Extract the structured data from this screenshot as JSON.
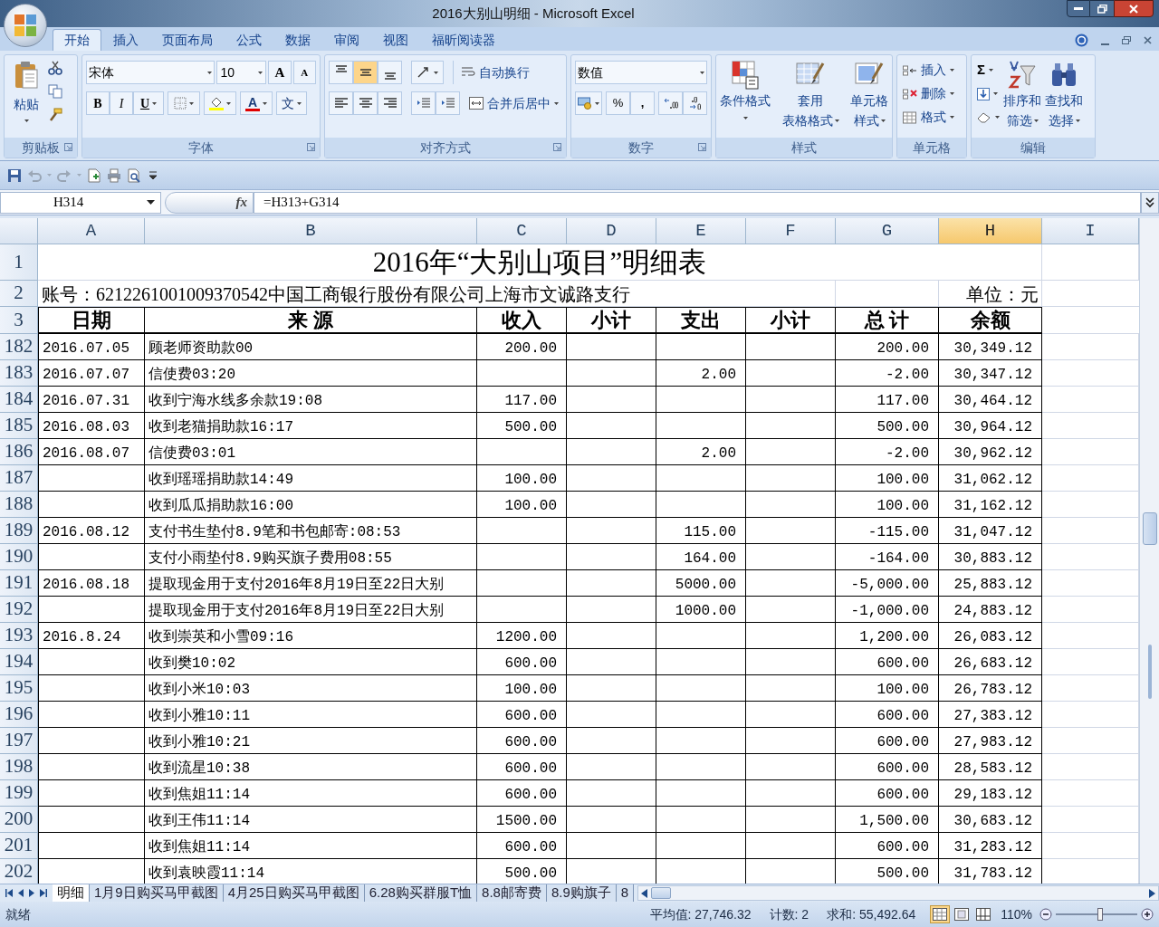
{
  "window": {
    "title": "2016大别山明细 - Microsoft Excel"
  },
  "ribbon_tabs": [
    {
      "label": "开始",
      "selected": true
    },
    {
      "label": "插入",
      "selected": false
    },
    {
      "label": "页面布局",
      "selected": false
    },
    {
      "label": "公式",
      "selected": false
    },
    {
      "label": "数据",
      "selected": false
    },
    {
      "label": "审阅",
      "selected": false
    },
    {
      "label": "视图",
      "selected": false
    },
    {
      "label": "福昕阅读器",
      "selected": false
    }
  ],
  "ribbon": {
    "clipboard": {
      "paste": "粘贴",
      "label": "剪贴板"
    },
    "font": {
      "name": "宋体",
      "size": "10",
      "grow": "A",
      "shrink": "A",
      "bold": "B",
      "italic": "I",
      "underline": "U",
      "font_color": "A",
      "phonetic": "文",
      "label": "字体"
    },
    "alignment": {
      "vertical": [
        {
          "selected": false
        },
        {
          "selected": true
        },
        {
          "selected": false
        }
      ],
      "wrap": "自动换行",
      "merge": "合并后居中",
      "label": "对齐方式"
    },
    "number": {
      "format": "数值",
      "percent": "%",
      "comma": ",",
      "label": "数字"
    },
    "styles": {
      "buttons": [
        {
          "lines": [
            "条件格式"
          ],
          "kind": "conditional"
        },
        {
          "lines": [
            "套用",
            "表格格式"
          ],
          "kind": "table"
        },
        {
          "lines": [
            "单元格",
            "样式"
          ],
          "kind": "cell"
        }
      ],
      "label": "样式"
    },
    "cells": {
      "buttons": [
        {
          "label": "插入",
          "kind": "insert"
        },
        {
          "label": "删除",
          "kind": "delete"
        },
        {
          "label": "格式",
          "kind": "format"
        }
      ],
      "label": "单元格"
    },
    "editing": {
      "sum": "Σ",
      "buttons": [
        {
          "lines": [
            "排序和",
            "筛选"
          ],
          "kind": "sort"
        },
        {
          "lines": [
            "查找和",
            "选择"
          ],
          "kind": "find"
        }
      ],
      "label": "编辑"
    }
  },
  "quick_access": [
    {
      "kind": "save",
      "disabled": false
    },
    {
      "kind": "undo",
      "disabled": true
    },
    {
      "kind": "redo",
      "disabled": true
    },
    {
      "kind": "new",
      "disabled": false
    },
    {
      "kind": "print",
      "disabled": false
    },
    {
      "kind": "preview",
      "disabled": false
    },
    {
      "kind": "customize",
      "disabled": false
    }
  ],
  "formula_bar": {
    "name_box": "H314",
    "function_label": "fx",
    "formula": "=H313+G314"
  },
  "sheet": {
    "columns": [
      {
        "label": "A",
        "selected": false
      },
      {
        "label": "B",
        "selected": false
      },
      {
        "label": "C",
        "selected": false
      },
      {
        "label": "D",
        "selected": false
      },
      {
        "label": "E",
        "selected": false
      },
      {
        "label": "F",
        "selected": false
      },
      {
        "label": "G",
        "selected": false
      },
      {
        "label": "H",
        "selected": true
      },
      {
        "label": "I",
        "selected": false
      }
    ],
    "title": "2016年“大别山项目”明细表",
    "account": "账号：6212261001009370542中国工商银行股份有限公司上海市文诚路支行",
    "unit": "单位：元",
    "headers": [
      "日期",
      "来 源",
      "收入",
      "小计",
      "支出",
      "小计",
      "总 计",
      "余额"
    ],
    "header_rows": [
      "1",
      "2",
      "3"
    ],
    "rows": [
      {
        "number": "182",
        "date": "2016.07.05",
        "source": "顾老师资助款00",
        "income": "200.00",
        "total": "200.00",
        "balance": "30,349.12"
      },
      {
        "number": "183",
        "date": "2016.07.07",
        "source": "信使费03:20",
        "expense": "2.00",
        "total": "-2.00",
        "balance": "30,347.12"
      },
      {
        "number": "184",
        "date": "2016.07.31",
        "source": "收到宁海水线多余款19:08",
        "income": "117.00",
        "total": "117.00",
        "balance": "30,464.12"
      },
      {
        "number": "185",
        "date": "2016.08.03",
        "source": "收到老猫捐助款16:17",
        "income": "500.00",
        "total": "500.00",
        "balance": "30,964.12"
      },
      {
        "number": "186",
        "date": "2016.08.07",
        "source": "信使费03:01",
        "expense": "2.00",
        "total": "-2.00",
        "balance": "30,962.12"
      },
      {
        "number": "187",
        "source": "收到瑶瑶捐助款14:49",
        "income": "100.00",
        "total": "100.00",
        "balance": "31,062.12"
      },
      {
        "number": "188",
        "source": "收到瓜瓜捐助款16:00",
        "income": "100.00",
        "total": "100.00",
        "balance": "31,162.12"
      },
      {
        "number": "189",
        "date": "2016.08.12",
        "source": "支付书生垫付8.9笔和书包邮寄:08:53",
        "expense": "115.00",
        "total": "-115.00",
        "balance": "31,047.12"
      },
      {
        "number": "190",
        "source": "支付小雨垫付8.9购买旗子费用08:55",
        "expense": "164.00",
        "total": "-164.00",
        "balance": "30,883.12"
      },
      {
        "number": "191",
        "date": "2016.08.18",
        "source": "提取现金用于支付2016年8月19日至22日大别",
        "expense": "5000.00",
        "total": "-5,000.00",
        "balance": "25,883.12"
      },
      {
        "number": "192",
        "source": "提取现金用于支付2016年8月19日至22日大别",
        "expense": "1000.00",
        "total": "-1,000.00",
        "balance": "24,883.12"
      },
      {
        "number": "193",
        "date": "2016.8.24",
        "source": "收到崇英和小雪09:16",
        "income": "1200.00",
        "total": "1,200.00",
        "balance": "26,083.12"
      },
      {
        "number": "194",
        "source": "收到樊10:02",
        "income": "600.00",
        "total": "600.00",
        "balance": "26,683.12"
      },
      {
        "number": "195",
        "source": "收到小米10:03",
        "income": "100.00",
        "total": "100.00",
        "balance": "26,783.12"
      },
      {
        "number": "196",
        "source": "收到小雅10:11",
        "income": "600.00",
        "total": "600.00",
        "balance": "27,383.12"
      },
      {
        "number": "197",
        "source": "收到小雅10:21",
        "income": "600.00",
        "total": "600.00",
        "balance": "27,983.12"
      },
      {
        "number": "198",
        "source": "收到流星10:38",
        "income": "600.00",
        "total": "600.00",
        "balance": "28,583.12"
      },
      {
        "number": "199",
        "source": "收到焦姐11:14",
        "income": "600.00",
        "total": "600.00",
        "balance": "29,183.12"
      },
      {
        "number": "200",
        "source": "收到王伟11:14",
        "income": "1500.00",
        "total": "1,500.00",
        "balance": "30,683.12"
      },
      {
        "number": "201",
        "source": "收到焦姐11:14",
        "income": "600.00",
        "total": "600.00",
        "balance": "31,283.12"
      },
      {
        "number": "202",
        "source": "收到袁映霞11:14",
        "income": "500.00",
        "total": "500.00",
        "balance": "31,783.12"
      }
    ]
  },
  "sheet_tabs": [
    {
      "label": "明细",
      "selected": true
    },
    {
      "label": "1月9日购买马甲截图",
      "selected": false
    },
    {
      "label": "4月25日购买马甲截图",
      "selected": false
    },
    {
      "label": "6.28购买群服T恤",
      "selected": false
    },
    {
      "label": "8.8邮寄费",
      "selected": false
    },
    {
      "label": "8.9购旗子",
      "selected": false
    },
    {
      "label": "8",
      "selected": false
    }
  ],
  "status_bar": {
    "mode": "就绪",
    "average": "平均值: 27,746.32",
    "count": "计数: 2",
    "sum": "求和: 55,492.64",
    "views": [
      {
        "kind": "normal",
        "selected": true
      },
      {
        "kind": "layout",
        "selected": false
      },
      {
        "kind": "page_break",
        "selected": false
      }
    ],
    "zoom": "110%",
    "zoom_slider": {
      "level": 0.55
    }
  }
}
